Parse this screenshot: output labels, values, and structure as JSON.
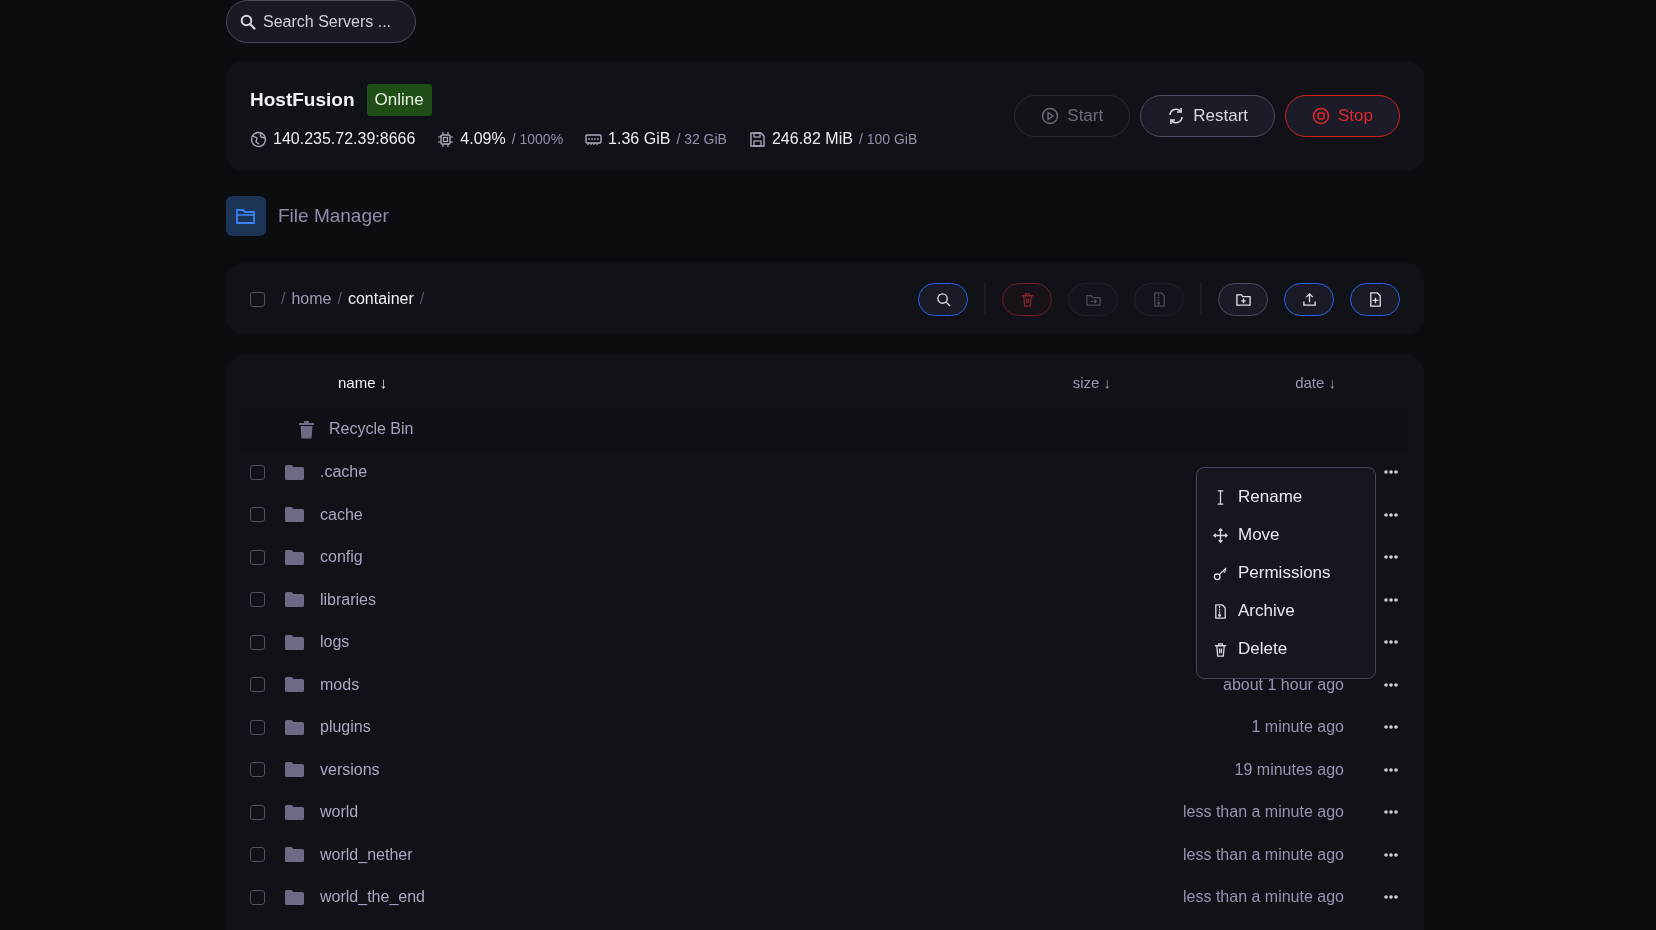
{
  "search": {
    "placeholder": "Search Servers ..."
  },
  "server": {
    "name": "HostFusion",
    "status": "Online",
    "online": true,
    "stats": [
      {
        "kind": "address",
        "value": "140.235.72.39:8666"
      },
      {
        "kind": "cpu",
        "value": "4.09%",
        "limit": "/ 1000%"
      },
      {
        "kind": "memory",
        "value": "1.36 GiB",
        "limit": "/ 32 GiB"
      },
      {
        "kind": "disk",
        "value": "246.82 MiB",
        "limit": "/ 100 GiB"
      }
    ],
    "buttons": [
      {
        "kind": "start",
        "label": "Start",
        "disabled": true
      },
      {
        "kind": "restart",
        "label": "Restart",
        "disabled": false
      },
      {
        "kind": "stop",
        "label": "Stop",
        "disabled": false
      }
    ]
  },
  "section": {
    "title": "File Manager"
  },
  "toolbar": {
    "select_all": {
      "checked": false
    },
    "breadcrumb": [
      {
        "label": "home",
        "current": false
      },
      {
        "label": "container",
        "current": true
      }
    ],
    "separator": "/",
    "buttons": [
      {
        "kind": "search",
        "disabled": false
      },
      {
        "kind": "delete",
        "disabled": true
      },
      {
        "kind": "move",
        "disabled": true
      },
      {
        "kind": "archive",
        "disabled": true
      },
      {
        "kind": "new-folder",
        "disabled": false
      },
      {
        "kind": "upload",
        "disabled": false
      },
      {
        "kind": "new-file",
        "disabled": false
      }
    ]
  },
  "table": {
    "columns": [
      {
        "label": "name ↓"
      },
      {
        "label": "size ↓"
      },
      {
        "label": "date ↓"
      }
    ],
    "recycle_bin": "Recycle Bin",
    "rows": [
      {
        "name": ".cache",
        "checked": false
      },
      {
        "name": "cache",
        "checked": false
      },
      {
        "name": "config",
        "checked": false
      },
      {
        "name": "libraries",
        "checked": false
      },
      {
        "name": "logs",
        "checked": false
      },
      {
        "name": "mods",
        "date": "about 1 hour ago",
        "checked": false
      },
      {
        "name": "plugins",
        "date": "1 minute ago",
        "checked": false
      },
      {
        "name": "versions",
        "date": "19 minutes ago",
        "checked": false
      },
      {
        "name": "world",
        "date": "less than a minute ago",
        "checked": false
      },
      {
        "name": "world_nether",
        "date": "less than a minute ago",
        "checked": false
      },
      {
        "name": "world_the_end",
        "date": "less than a minute ago",
        "checked": false
      }
    ]
  },
  "context_menu": {
    "items": [
      {
        "kind": "rename",
        "label": "Rename"
      },
      {
        "kind": "move",
        "label": "Move"
      },
      {
        "kind": "permissions",
        "label": "Permissions"
      },
      {
        "kind": "archive",
        "label": "Archive"
      },
      {
        "kind": "delete",
        "label": "Delete"
      }
    ]
  }
}
